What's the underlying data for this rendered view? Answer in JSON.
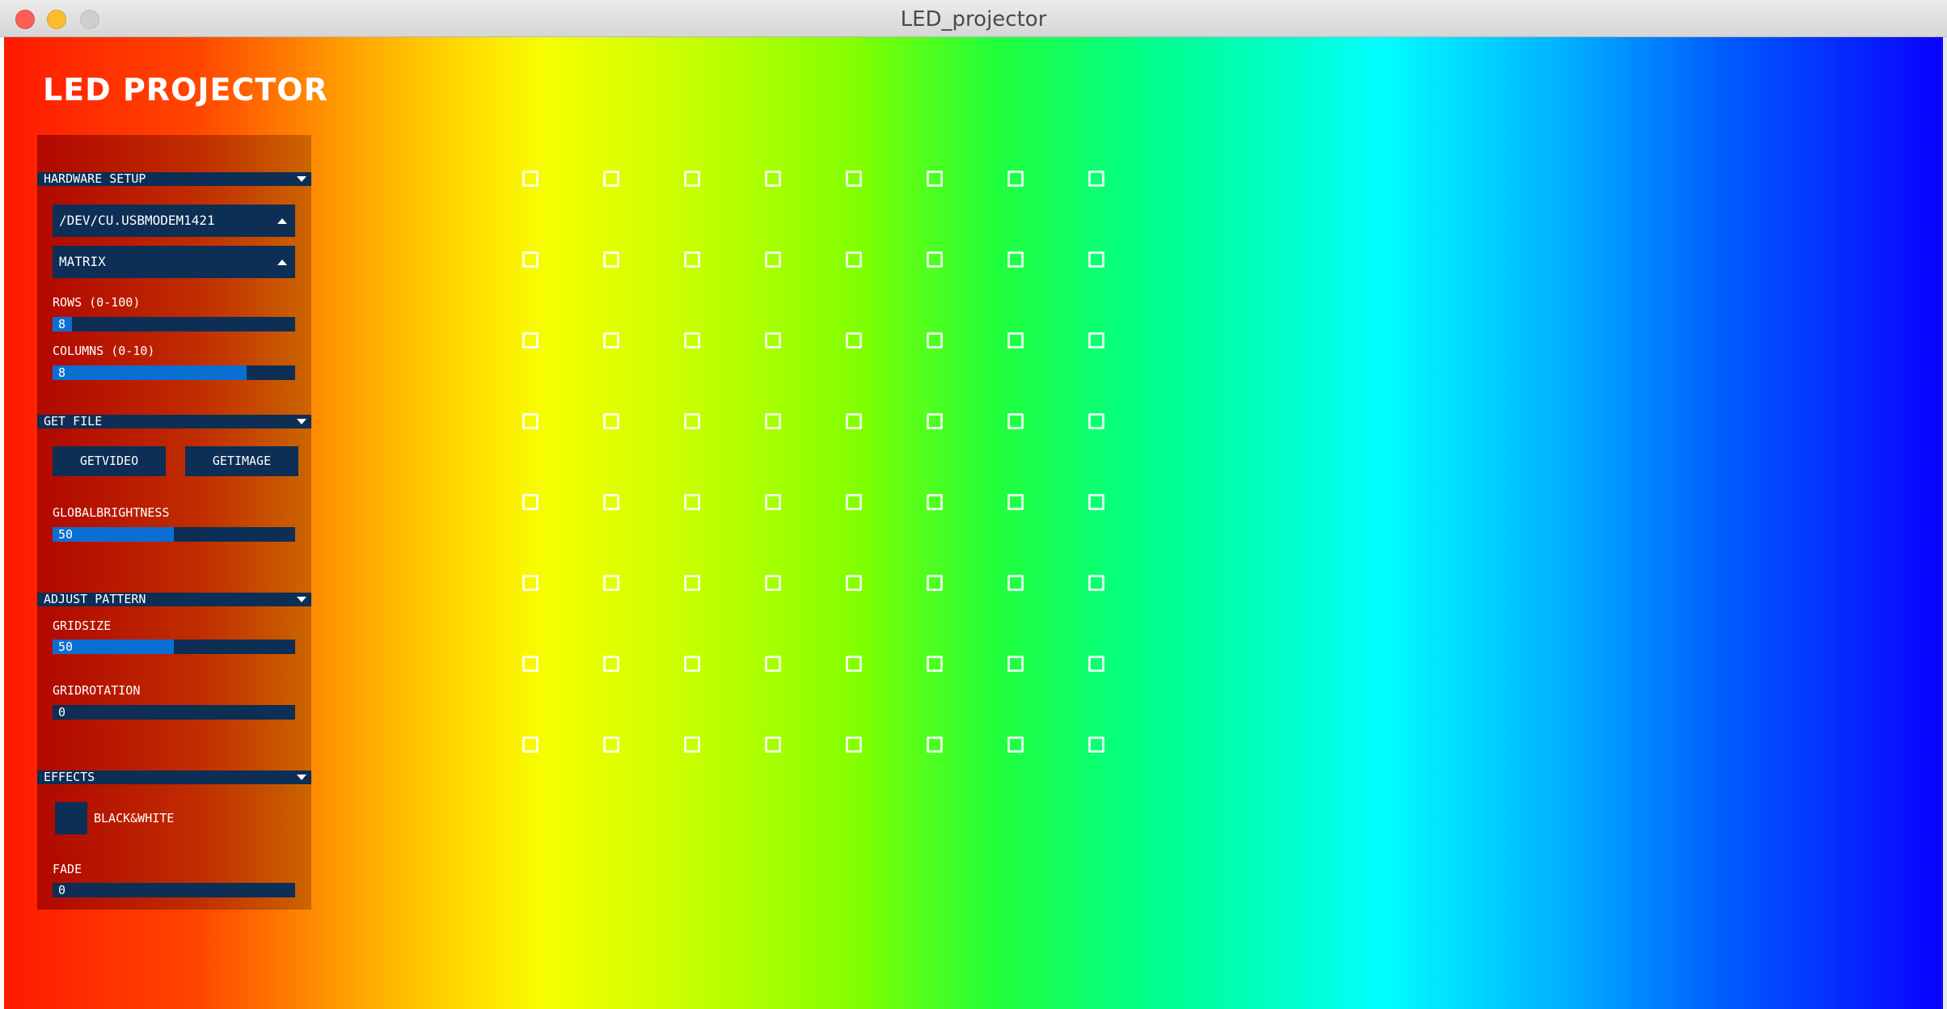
{
  "window": {
    "title": "LED_projector"
  },
  "app": {
    "title": "LED PROJECTOR"
  },
  "hardware_setup": {
    "header": "HARDWARE SETUP",
    "port_dropdown": "/DEV/CU.USBMODEM1421",
    "mode_dropdown": "MATRIX",
    "rows": {
      "label": "ROWS (0-100)",
      "value": "8",
      "fraction": 0.08
    },
    "columns": {
      "label": "COLUMNS (0-10)",
      "value": "8",
      "fraction": 0.8
    }
  },
  "get_file": {
    "header": "GET FILE",
    "get_video": "GETVIDEO",
    "get_image": "GETIMAGE",
    "brightness": {
      "label": "GLOBALBRIGHTNESS",
      "value": "50",
      "fraction": 0.5
    }
  },
  "adjust_pattern": {
    "header": "ADJUST PATTERN",
    "gridsize": {
      "label": "GRIDSIZE",
      "value": "50",
      "fraction": 0.5
    },
    "gridrotation": {
      "label": "GRIDROTATION",
      "value": "0",
      "fraction": 0
    }
  },
  "effects": {
    "header": "EFFECTS",
    "black_white": "BLACK&WHITE",
    "fade": {
      "label": "FADE",
      "value": "0",
      "fraction": 0
    }
  },
  "led_matrix": {
    "rows": 8,
    "columns": 8
  }
}
